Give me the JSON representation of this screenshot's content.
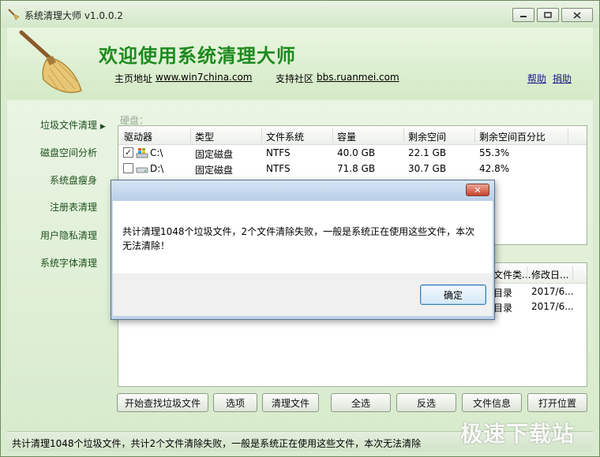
{
  "window": {
    "title": "系统清理大师 v1.0.0.2",
    "controls": [
      "minimize",
      "maximize",
      "close"
    ]
  },
  "header": {
    "headline": "欢迎使用系统清理大师",
    "homepage_label": "主页地址",
    "homepage_link": "www.win7china.com",
    "community_label": "支持社区",
    "community_link": "bbs.ruanmei.com",
    "help": "帮助",
    "donate": "捐助"
  },
  "sidebar": {
    "items": [
      {
        "label": "垃圾文件清理",
        "active": true
      },
      {
        "label": "磁盘空间分析"
      },
      {
        "label": "系统盘瘦身"
      },
      {
        "label": "注册表清理"
      },
      {
        "label": "用户隐私清理"
      },
      {
        "label": "系统字体清理"
      }
    ],
    "arrow": "▶"
  },
  "disk_group": {
    "label": "硬盘：",
    "columns": [
      "驱动器",
      "类型",
      "文件系统",
      "容量",
      "剩余空间",
      "剩余空间百分比"
    ],
    "rows": [
      {
        "checked": true,
        "drive": "C:\\",
        "type": "固定磁盘",
        "fs": "NTFS",
        "capacity": "40.0 GB",
        "free": "22.1 GB",
        "percent": "55.3%"
      },
      {
        "checked": false,
        "drive": "D:\\",
        "type": "固定磁盘",
        "fs": "NTFS",
        "capacity": "71.8 GB",
        "free": "30.7 GB",
        "percent": "42.8%"
      }
    ]
  },
  "files": {
    "columns": [
      "文件类...",
      "修改日..."
    ],
    "rows": [
      {
        "type": "目录",
        "date": "2017/6..."
      },
      {
        "type": "目录",
        "date": "2017/6..."
      }
    ]
  },
  "buttons": {
    "scan": "开始查找垃圾文件",
    "options": "选项",
    "clean": "清理文件",
    "select_all": "全选",
    "invert": "反选",
    "file_info": "文件信息",
    "open_location": "打开位置"
  },
  "status": {
    "text": "共计清理1048个垃圾文件，共计2个文件清除失败，一般是系统正在使用这些文件，本次无法清除"
  },
  "watermark": "极速下载站",
  "dialog": {
    "close_glyph": "✕",
    "message": "共计清理1048个垃圾文件，2个文件清除失败，一般是系统正在使用这些文件，本次无法清除！",
    "ok": "确定"
  }
}
